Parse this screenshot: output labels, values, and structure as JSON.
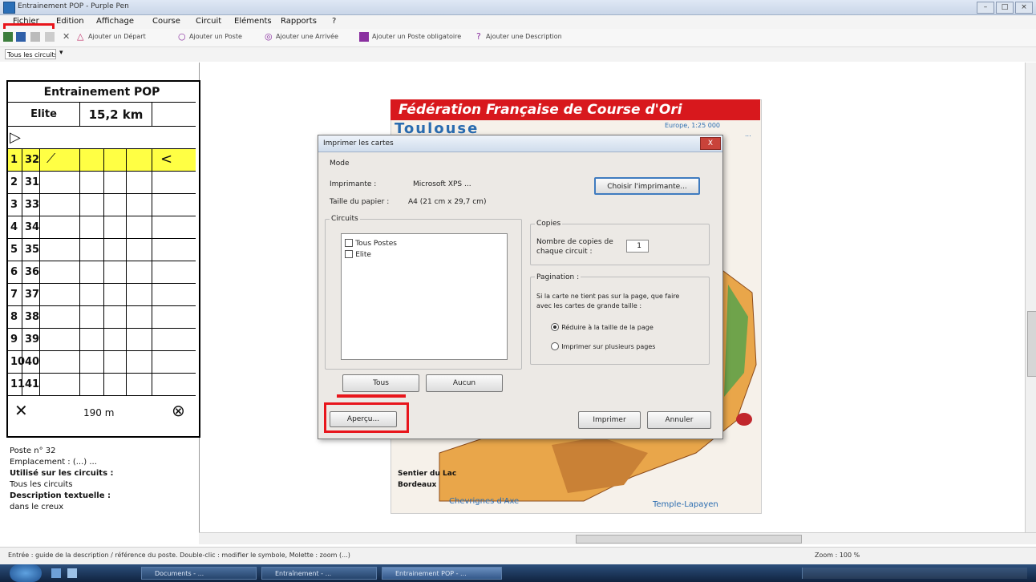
{
  "window": {
    "title": "Entrainement POP - Purple Pen"
  },
  "menus": [
    "Fichier",
    "Edition",
    "Affichage",
    "Course",
    "Circuit",
    "Eléments",
    "Rapports",
    "?"
  ],
  "toolbar": {
    "items": [
      "Ajouter un Départ",
      "Ajouter un Poste",
      "Ajouter une Arrivée",
      "Ajouter un Poste obligatoire",
      "Ajouter une Description"
    ]
  },
  "row3": {
    "selector": "Tous les circuits"
  },
  "description_sheet": {
    "title": "Entrainement POP",
    "course": "Elite",
    "length": "15,2 km",
    "start_symbol": "▷",
    "rows": [
      {
        "num": "1",
        "code": "32"
      },
      {
        "num": "2",
        "code": "31"
      },
      {
        "num": "3",
        "code": "33"
      },
      {
        "num": "4",
        "code": "34"
      },
      {
        "num": "5",
        "code": "35"
      },
      {
        "num": "6",
        "code": "36"
      },
      {
        "num": "7",
        "code": "37"
      },
      {
        "num": "8",
        "code": "38"
      },
      {
        "num": "9",
        "code": "39"
      },
      {
        "num": "10",
        "code": "40"
      },
      {
        "num": "11",
        "code": "41"
      }
    ],
    "finish_distance": "190 m",
    "highlight_color": "#ffff44"
  },
  "info_panel": {
    "line1": "Poste n° 32",
    "line2": "Emplacement :  (...)   ...",
    "line3": "Utilisé sur les circuits :",
    "line4": "  Tous les circuits",
    "line5": "Description textuelle :",
    "line6": "  dans le creux"
  },
  "map": {
    "header": "Fédération Française de Course d'Ori",
    "sub_right_1": "Europe, 1:25 000",
    "sub_right_2": "...",
    "label_bottom_left": "Sentier du Lac",
    "label_bottom_left2": "Bordeaux",
    "label_bottom_mid": "Chevrignes d'Axe",
    "label_bottom_right": "Temple-Lapayen",
    "brand_color": "#d8181d"
  },
  "dialog": {
    "title": "Imprimer les cartes",
    "close_label": "X",
    "printer_group": "Mode",
    "printer_label": "Imprimante :",
    "printer_value": "Microsoft XPS ...",
    "paper_label": "Taille du papier :",
    "paper_value": "A4 (21 cm x 29,7 cm)",
    "change_button": "Choisir l'imprimante...",
    "courses_group": "Circuits",
    "courses": [
      "Tous Postes",
      "Elite"
    ],
    "all_button": "Tous",
    "none_button": "Aucun",
    "copies_group": "Copies",
    "copies_label_1": "Nombre de copies de",
    "copies_label_2": "chaque circuit :",
    "copies_value": "1",
    "arrange_label": "Pagination :",
    "arrange_desc_1": "Si la carte ne tient pas sur la page, que faire",
    "arrange_desc_2": "avec les cartes de grande taille :",
    "option_1": "Réduire à la taille de la page",
    "option_2": "Imprimer sur plusieurs pages",
    "preview_button": "Aperçu...",
    "print_button": "Imprimer",
    "cancel_button": "Annuler"
  },
  "statusbar": {
    "text": "Entrée : guide de la description / référence du poste. Double-clic : modifier le symbole, Molette : zoom (...)",
    "right": "Zoom : 100 %"
  },
  "taskbar": {
    "tasks": [
      "Documents - ...",
      "Entraînement - ...",
      "Entrainement POP - ..."
    ]
  }
}
